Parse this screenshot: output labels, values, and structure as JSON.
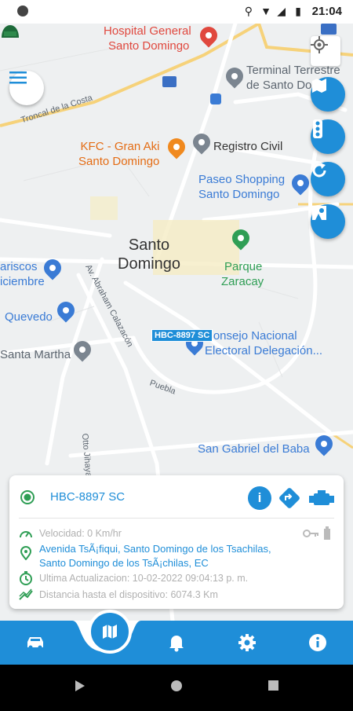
{
  "status_bar": {
    "time": "21:04"
  },
  "map": {
    "city_label": "Santo\nDomingo",
    "city_line1": "Santo",
    "city_line2": "Domingo",
    "pois": {
      "hospital": "Hospital General\nSanto Domingo",
      "hospital_l1": "Hospital General",
      "hospital_l2": "Santo Domingo",
      "terminal_l1": "Terminal Terrestre",
      "terminal_l2": "de Santo Do",
      "kfc_l1": "KFC - Gran Aki",
      "kfc_l2": "Santo Domingo",
      "registro": "Registro Civil",
      "paseo_l1": "Paseo Shopping",
      "paseo_l2": "Santo Domingo",
      "parque_l1": "Parque",
      "parque_l2": "Zaracay",
      "mariscos_l1": "ariscos",
      "mariscos_l2": "iciembre",
      "quevedo": "Quevedo",
      "consejo_l1": "Consejo Nacional",
      "consejo_l2": "Electoral Delegación...",
      "santa_martha": "Santa Martha",
      "san_gabriel": "San Gabriel del Baba",
      "troncal": "Troncal de la Costa",
      "abraham": "Av. Abraham Calazacón",
      "puebla": "Puebla",
      "jihaya": "Otto Jihaya"
    },
    "vehicle_label": "HBC-8897 SC"
  },
  "controls": {
    "menu_icon": "hamburger-icon",
    "location_icon": "crosshair-icon",
    "layers_icon": "map-icon",
    "traffic_icon": "traffic-light-icon",
    "refresh_icon": "refresh-icon",
    "street_view_icon": "street-view-icon"
  },
  "card": {
    "vehicle_name": "HBC-8897 SC",
    "speed": "Velocidad: 0 Km/hr",
    "address_l1": "Avenida TsÃ¡fiqui, Santo Domingo de los Tsachilas,",
    "address_l2": "Santo Domingo de los TsÃ¡chilas, EC",
    "last_update": "Ultima Actualizacion: 10-02-2022 09:04:13 p. m.",
    "distance": "Distancia hasta el dispositivo: 6074.3 Km"
  },
  "bottom_nav": {
    "items": [
      "car-icon",
      "map-icon",
      "bell-icon",
      "gear-icon",
      "info-icon"
    ]
  },
  "colors": {
    "primary": "#1f8ed8",
    "green": "#2f9e55"
  }
}
